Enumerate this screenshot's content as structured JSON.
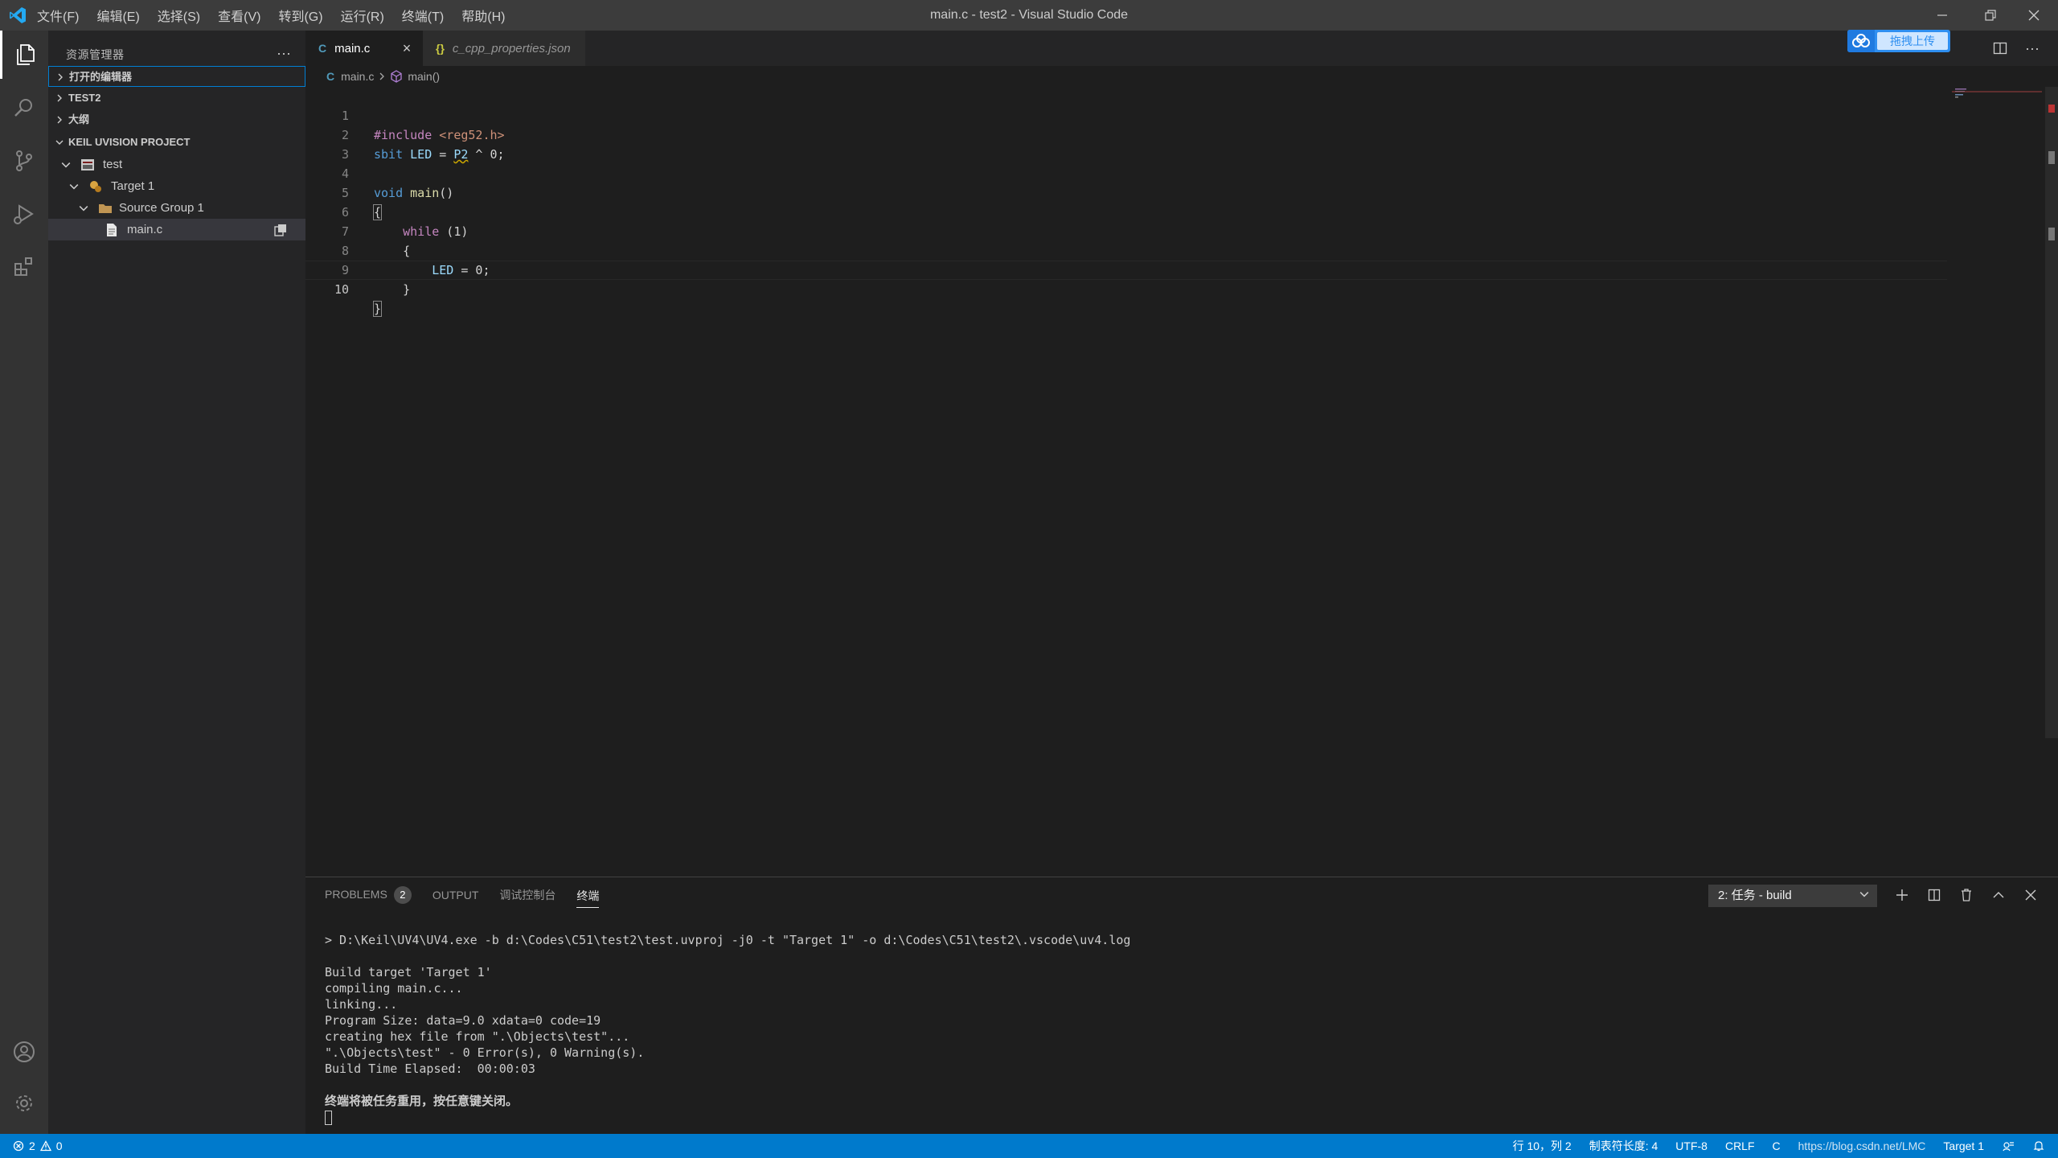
{
  "window": {
    "title": "main.c - test2 - Visual Studio Code",
    "menu": [
      "文件(F)",
      "编辑(E)",
      "选择(S)",
      "查看(V)",
      "转到(G)",
      "运行(R)",
      "终端(T)",
      "帮助(H)"
    ]
  },
  "sidebar": {
    "header": "资源管理器",
    "sections": {
      "open_editors": "打开的编辑器",
      "test2": "TEST2",
      "outline": "大纲",
      "keil": "KEIL UVISION PROJECT"
    },
    "tree": {
      "project": "test",
      "target": "Target 1",
      "group": "Source Group 1",
      "file": "main.c"
    }
  },
  "tabs": [
    {
      "icon": "C",
      "label": "main.c"
    },
    {
      "icon": "{}",
      "label": "c_cpp_properties.json"
    }
  ],
  "upload": {
    "label": "拖拽上传"
  },
  "breadcrumb": {
    "file": "main.c",
    "symbol": "main()"
  },
  "editor": {
    "line_numbers": [
      "1",
      "2",
      "3",
      "4",
      "5",
      "6",
      "7",
      "8",
      "9",
      "10"
    ],
    "lines": {
      "l1_kw": "#include",
      "l1_str": " <reg52.h>",
      "l2_kw": "sbit",
      "l2_var": " LED",
      "l2_eq": " = ",
      "l2_p2": "P2",
      "l2_rest": " ^ 0;",
      "l4_kw": "void",
      "l4_fn": " main",
      "l4_paren": "()",
      "l5": "{",
      "l6_kw": "    while",
      "l6_rest": " (1)",
      "l7": "    {",
      "l8_var": "        LED",
      "l8_rest": " = 0;",
      "l9": "    }",
      "l10": "}"
    }
  },
  "panel": {
    "tabs": {
      "problems": "PROBLEMS",
      "problems_count": "2",
      "output": "OUTPUT",
      "debug": "调试控制台",
      "terminal": "终端"
    },
    "terminal_select": "2: 任务 - build",
    "terminal_lines": [
      "> D:\\Keil\\UV4\\UV4.exe -b d:\\Codes\\C51\\test2\\test.uvproj -j0 -t \"Target 1\" -o d:\\Codes\\C51\\test2\\.vscode\\uv4.log",
      "",
      "Build target 'Target 1'",
      "compiling main.c...",
      "linking...",
      "Program Size: data=9.0 xdata=0 code=19",
      "creating hex file from \".\\Objects\\test\"...",
      "\".\\Objects\\test\" - 0 Error(s), 0 Warning(s).",
      "Build Time Elapsed:  00:00:03",
      "",
      "终端将被任务重用，按任意键关闭。"
    ]
  },
  "status": {
    "errors": "2",
    "warnings": "0",
    "position": "行 10，列 2",
    "tab_size": "制表符长度: 4",
    "encoding": "UTF-8",
    "eol": "CRLF",
    "language": "C",
    "target": "Target 1",
    "watermark": "https://blog.csdn.net/LMC"
  },
  "colors": {
    "accent": "#007acc",
    "titlebar": "#3c3c3c",
    "sidebar": "#252526",
    "editor": "#1e1e1e"
  }
}
